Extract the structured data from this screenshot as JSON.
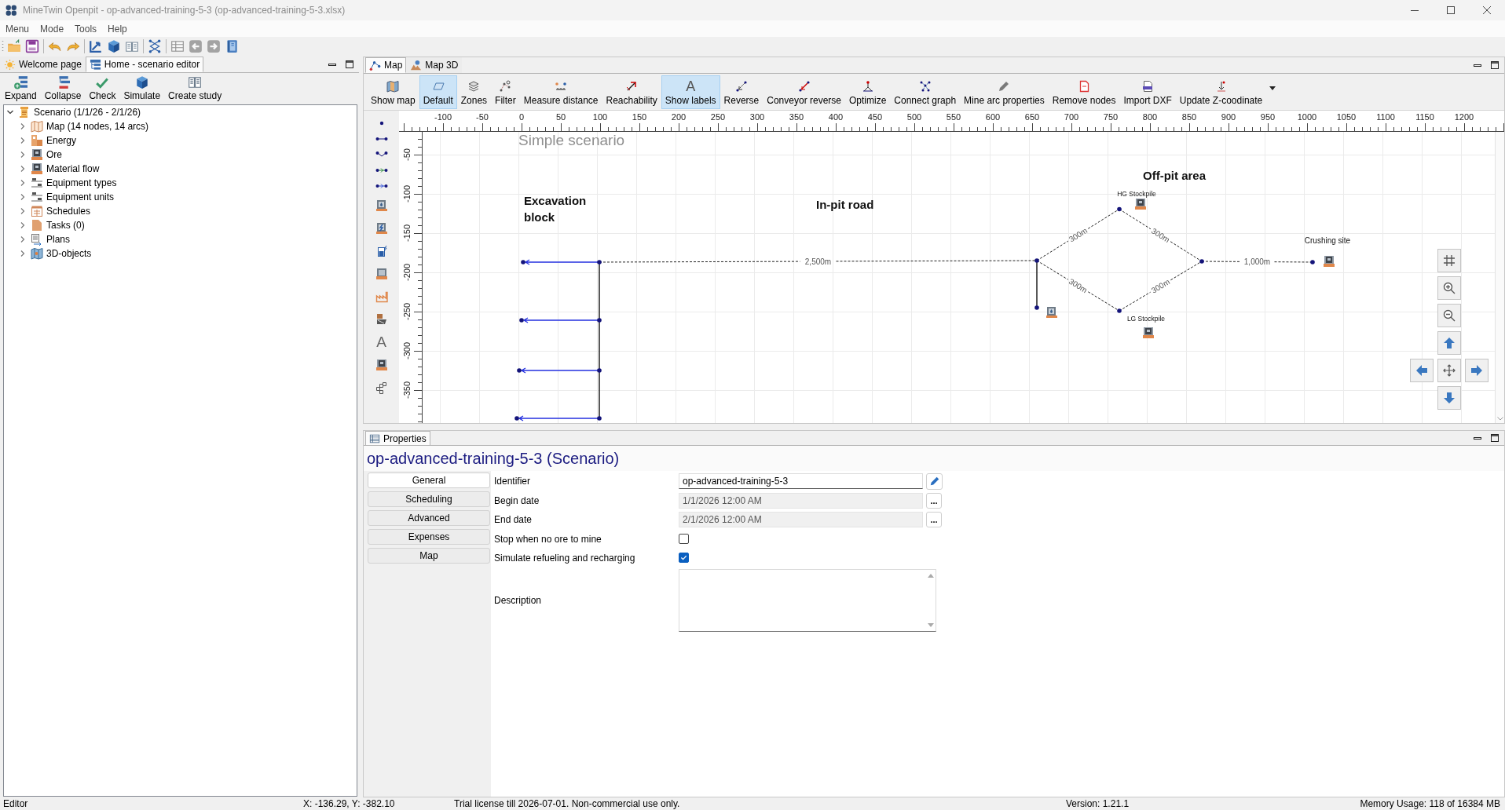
{
  "window": {
    "title": "MineTwin Openpit - op-advanced-training-5-3 (op-advanced-training-5-3.xlsx)"
  },
  "menu": [
    "Menu",
    "Mode",
    "Tools",
    "Help"
  ],
  "toolbar_groups": [
    [
      {
        "kind": "open",
        "disabled": false
      },
      {
        "kind": "save",
        "disabled": false
      }
    ],
    [
      {
        "kind": "undo",
        "disabled": false
      },
      {
        "kind": "redo",
        "disabled": false
      }
    ],
    [
      {
        "kind": "select",
        "disabled": false
      },
      {
        "kind": "cube",
        "disabled": false
      },
      {
        "kind": "book",
        "disabled": false
      }
    ],
    [
      {
        "kind": "network",
        "disabled": false
      }
    ],
    [
      {
        "kind": "table",
        "disabled": true
      },
      {
        "kind": "back",
        "disabled": true
      },
      {
        "kind": "forward",
        "disabled": true
      },
      {
        "kind": "manual",
        "disabled": false
      }
    ]
  ],
  "left_panel": {
    "tabs": [
      {
        "label": "Welcome page",
        "kind": "welcome",
        "selected": false
      },
      {
        "label": "Home - scenario editor",
        "kind": "editor",
        "selected": true
      }
    ],
    "toolbar": [
      {
        "label": "Expand",
        "kind": "expand"
      },
      {
        "label": "Collapse",
        "kind": "collapse"
      },
      {
        "label": "Check",
        "kind": "check"
      },
      {
        "label": "Simulate",
        "kind": "simulate"
      },
      {
        "label": "Create study",
        "kind": "study"
      }
    ],
    "tree": [
      {
        "label": "Scenario (1/1/26 - 2/1/26)",
        "kind": "scenario",
        "expanded": true,
        "children": [
          {
            "label": "Map (14 nodes, 14 arcs)",
            "kind": "map",
            "expanded": false
          },
          {
            "label": "Energy",
            "kind": "energy",
            "expanded": false
          },
          {
            "label": "Ore",
            "kind": "ore",
            "expanded": false
          },
          {
            "label": "Material flow",
            "kind": "ore",
            "expanded": false
          },
          {
            "label": "Equipment types",
            "kind": "equipment",
            "expanded": false
          },
          {
            "label": "Equipment units",
            "kind": "equipment",
            "expanded": false
          },
          {
            "label": "Schedules",
            "kind": "schedules",
            "expanded": false
          },
          {
            "label": "Tasks (0)",
            "kind": "tasks",
            "expanded": false
          },
          {
            "label": "Plans",
            "kind": "plans",
            "expanded": false
          },
          {
            "label": "3D-objects",
            "kind": "objects",
            "expanded": false
          }
        ]
      }
    ]
  },
  "map_panel": {
    "tabs": [
      {
        "label": "Map",
        "kind": "map",
        "selected": true
      },
      {
        "label": "Map 3D",
        "kind": "map3d",
        "selected": false
      }
    ],
    "toolbar": [
      {
        "label": "Show map",
        "kind": "show-map",
        "selected": false
      },
      {
        "label": "Default",
        "kind": "default",
        "selected": true
      },
      {
        "label": "Zones",
        "kind": "zones",
        "selected": false
      },
      {
        "label": "Filter",
        "kind": "filter",
        "selected": false
      },
      {
        "label": "Measure distance",
        "kind": "measure",
        "selected": false
      },
      {
        "label": "Reachability",
        "kind": "reachability",
        "selected": false
      },
      {
        "label": "Show labels",
        "kind": "labels",
        "glyph": "A",
        "selected": true
      },
      {
        "label": "Reverse",
        "kind": "reverse",
        "selected": false
      },
      {
        "label": "Conveyor reverse",
        "kind": "conveyor-reverse",
        "selected": false
      },
      {
        "label": "Optimize",
        "kind": "optimize",
        "selected": false
      },
      {
        "label": "Connect graph",
        "kind": "connect",
        "selected": false
      },
      {
        "label": "Mine arc properties",
        "kind": "arc-properties",
        "selected": false
      },
      {
        "label": "Remove nodes",
        "kind": "remove-nodes",
        "selected": false
      },
      {
        "label": "Import DXF",
        "kind": "import-dxf",
        "selected": false
      },
      {
        "label": "Update Z-coodinate",
        "kind": "update-z",
        "selected": false
      }
    ],
    "tools": [
      {
        "kind": "dot"
      },
      {
        "kind": "line"
      },
      {
        "kind": "zigzag"
      },
      {
        "kind": "arrow-green"
      },
      {
        "kind": "arrow-blue"
      },
      {
        "kind": "pump"
      },
      {
        "kind": "bolt-box"
      },
      {
        "kind": "bolt-doc"
      },
      {
        "kind": "hut"
      },
      {
        "kind": "factory"
      },
      {
        "kind": "loader"
      },
      {
        "kind": "letter",
        "glyph": "A"
      },
      {
        "kind": "crusher"
      },
      {
        "kind": "blocks"
      }
    ],
    "title": "Simple scenario",
    "ruler_x_labels": [
      "-100",
      "-50",
      "0",
      "50",
      "100",
      "150",
      "200",
      "250",
      "300",
      "350",
      "400",
      "450",
      "500",
      "550",
      "600",
      "650",
      "700",
      "750",
      "800",
      "850",
      "900",
      "950",
      "1000",
      "1050",
      "1100",
      "1150",
      "1200"
    ],
    "ruler_y_labels": [
      "-50",
      "-100",
      "-150",
      "-200",
      "-250",
      "-300",
      "-350"
    ],
    "area_labels": [
      "Excavation block",
      "In-pit road",
      "Off-pit area"
    ],
    "site_labels": [
      "HG Stockpile",
      "LG Stockpile",
      "Crushing site"
    ],
    "distance_labels": [
      "2,500m",
      "300m",
      "300m",
      "300m",
      "300m",
      "1,000m"
    ]
  },
  "properties": {
    "tab": "Properties",
    "heading": "op-advanced-training-5-3 (Scenario)",
    "categories": [
      {
        "label": "General",
        "selected": true
      },
      {
        "label": "Scheduling",
        "selected": false
      },
      {
        "label": "Advanced",
        "selected": false
      },
      {
        "label": "Expenses",
        "selected": false
      },
      {
        "label": "Map",
        "selected": false
      }
    ],
    "fields": [
      {
        "kind": "text",
        "label": "Identifier",
        "value": "op-advanced-training-5-3"
      },
      {
        "kind": "date",
        "label": "Begin date",
        "value": "1/1/2026 12:00 AM",
        "disabled": true,
        "button": "..."
      },
      {
        "kind": "date",
        "label": "End date",
        "value": "2/1/2026 12:00 AM",
        "disabled": true,
        "button": "..."
      },
      {
        "kind": "checkbox",
        "label": "Stop when no ore to mine",
        "checked": false
      },
      {
        "kind": "checkbox",
        "label": "Simulate refueling and recharging",
        "checked": true
      },
      {
        "kind": "textarea",
        "label": "Description"
      }
    ]
  },
  "status_bar": {
    "mode": "Editor",
    "cursor": "X: -136.29, Y: -382.10",
    "license": "Trial license till 2026-07-01. Non-commercial use only.",
    "version": "Version: 1.21.1",
    "memory": "Memory Usage: 118 of 16384 MB"
  }
}
